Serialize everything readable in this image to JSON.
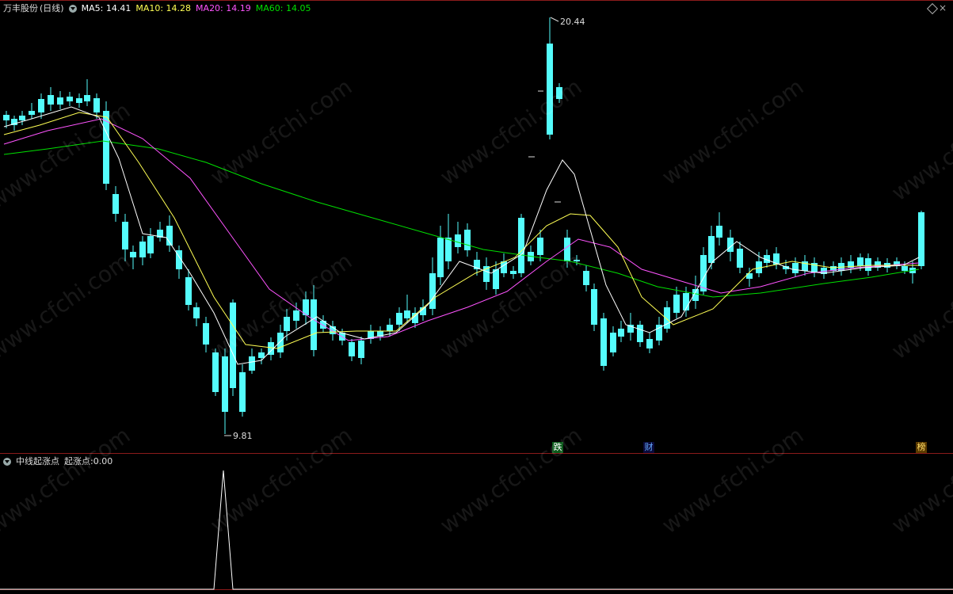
{
  "header": {
    "stock_name": "万丰股份",
    "period": "(日线)",
    "ma5_label": "MA5:",
    "ma5_value": "14.41",
    "ma10_label": "MA10:",
    "ma10_value": "14.28",
    "ma20_label": "MA20:",
    "ma20_value": "14.19",
    "ma60_label": "MA60:",
    "ma60_value": "14.05",
    "close_symbol": "×"
  },
  "price_chart": {
    "high_label": "20.44",
    "low_label": "9.81",
    "colors": {
      "up": "#ff3a3a",
      "down": "#54fcfc",
      "ma5": "#ffffff",
      "ma10": "#ffff54",
      "ma20": "#ff54ff",
      "ma60": "#00e000"
    }
  },
  "event_tags": [
    {
      "text": "跌",
      "bg": "#0a5a1a",
      "fg": "#ffffff"
    },
    {
      "text": "财",
      "bg": "#0a0a3a",
      "fg": "#66aaff"
    },
    {
      "text": "榜",
      "bg": "#5a3a00",
      "fg": "#ffdd66"
    }
  ],
  "indicator": {
    "name": "中线起涨点",
    "series_label": "起涨点:",
    "series_value": "0.00",
    "color": "#ffffff"
  },
  "watermark_text": "www.cfchi.com"
}
